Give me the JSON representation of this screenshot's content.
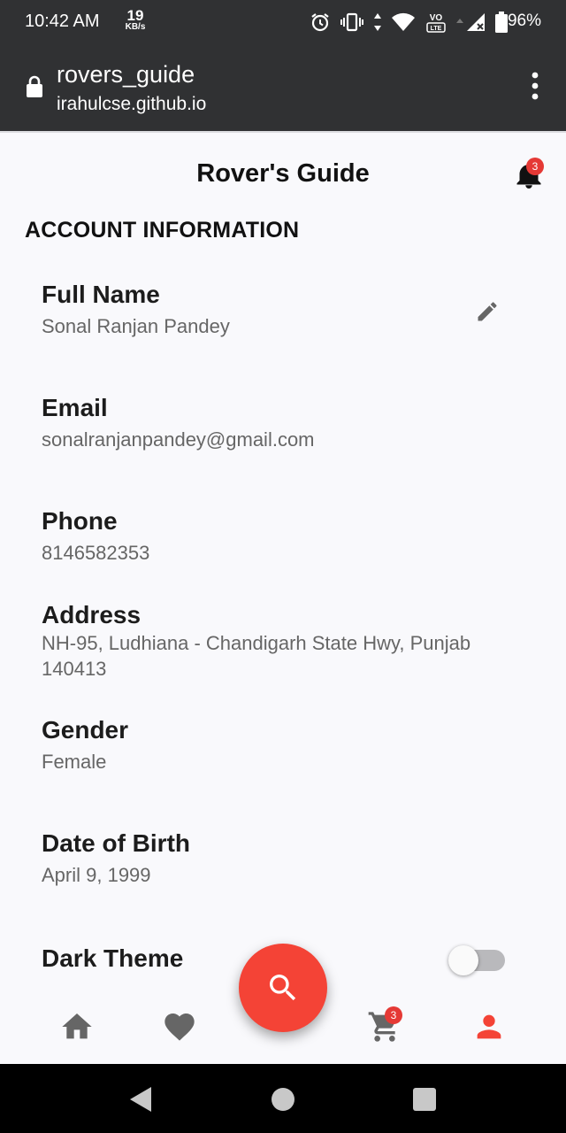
{
  "status_bar": {
    "time": "10:42 AM",
    "speed_value": "19",
    "speed_unit": "KB/s",
    "battery_percent": "96%",
    "icons": [
      "alarm-icon",
      "vibrate-icon",
      "data-arrows-icon",
      "wifi-icon",
      "volte-icon",
      "signal-icon",
      "battery-icon"
    ]
  },
  "browser": {
    "site_name": "rovers_guide",
    "url": "irahulcse.github.io",
    "icons": [
      "lock-icon",
      "more-vert-icon"
    ]
  },
  "header": {
    "title": "Rover's Guide",
    "notification_count": "3"
  },
  "account": {
    "section_title": "ACCOUNT INFORMATION",
    "fields": [
      {
        "label": "Full Name",
        "value": "Sonal Ranjan Pandey"
      },
      {
        "label": "Email",
        "value": "sonalranjanpandey@gmail.com"
      },
      {
        "label": "Phone",
        "value": "8146582353"
      },
      {
        "label": "Address",
        "value": "NH-95, Ludhiana - Chandigarh State Hwy, Punjab 140413"
      },
      {
        "label": "Gender",
        "value": "Female"
      },
      {
        "label": "Date of Birth",
        "value": "April 9, 1999"
      }
    ],
    "dark_theme_label": "Dark Theme",
    "dark_theme_enabled": false
  },
  "bottom_nav": {
    "items": [
      "home-icon",
      "favorite-icon",
      "search-icon",
      "cart-icon",
      "profile-icon"
    ],
    "cart_count": "3",
    "active_item": "profile",
    "active_color": "#f44336",
    "inactive_color": "#666666"
  },
  "colors": {
    "accent": "#f44336",
    "badge": "#e53935",
    "status_bar": "#303133",
    "background": "#f9f9fc"
  }
}
